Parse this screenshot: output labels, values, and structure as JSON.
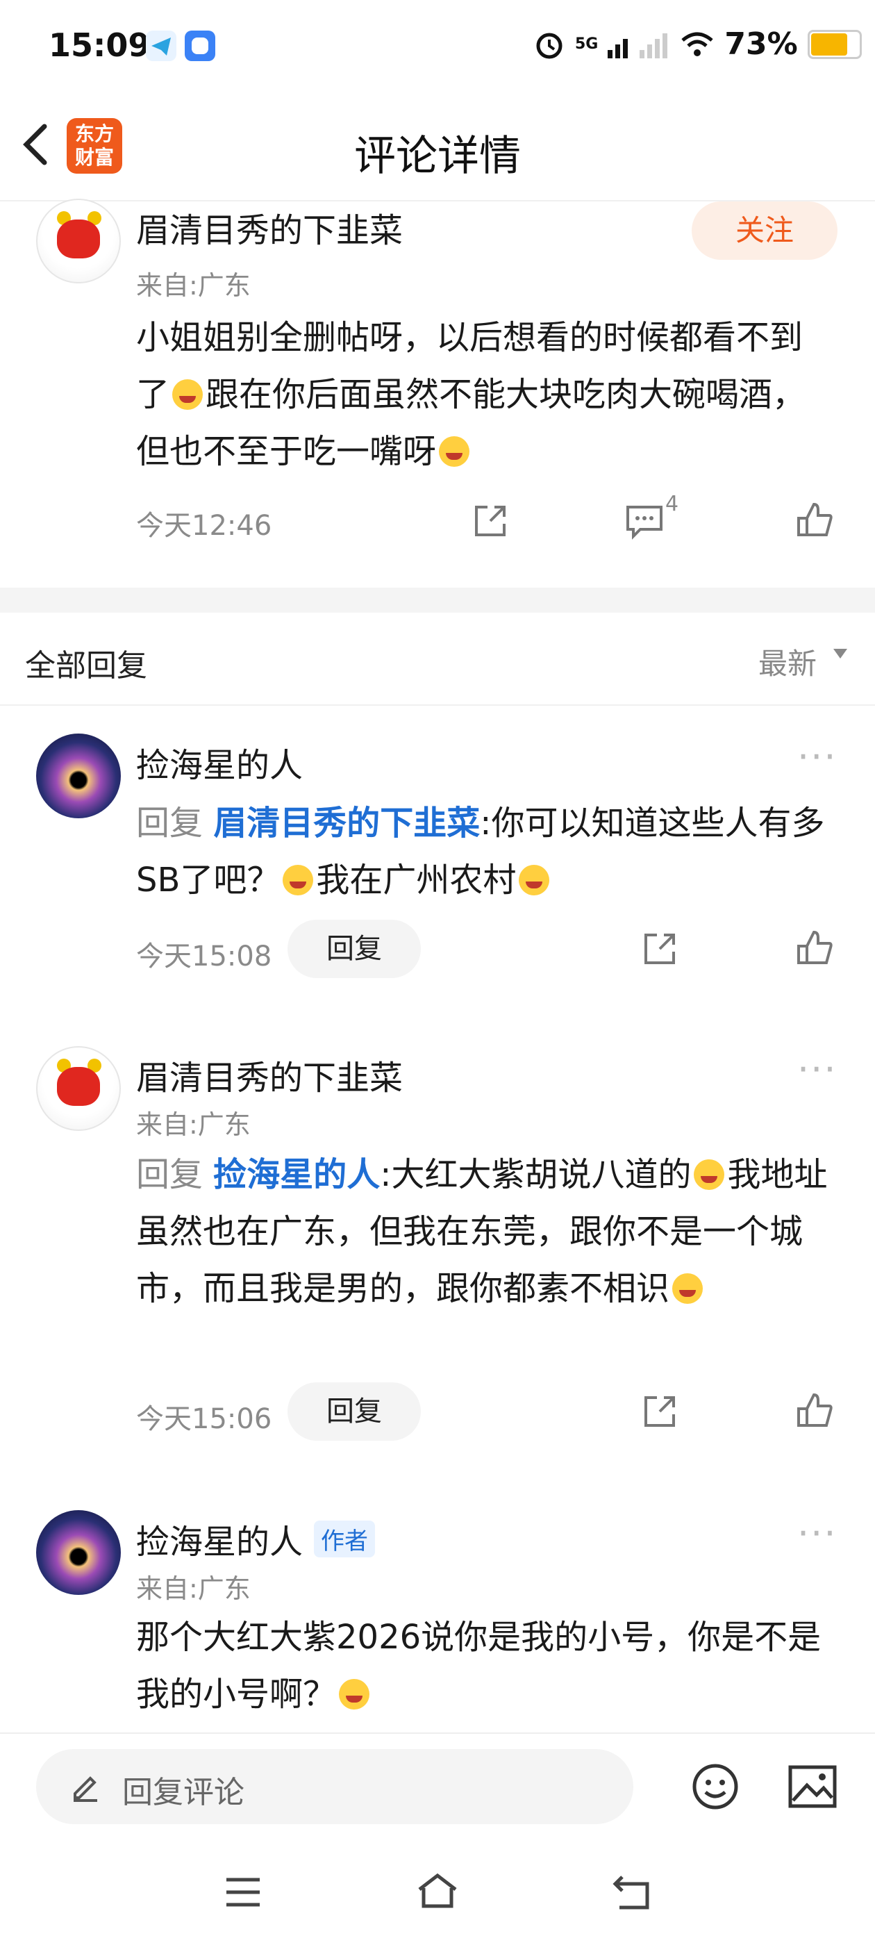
{
  "status_bar": {
    "time": "15:09",
    "network": "5G",
    "battery": "73%",
    "battery_level": 0.73
  },
  "header": {
    "logo_text": "东方财富",
    "title": "评论详情"
  },
  "main_comment": {
    "username": "眉清目秀的下韭菜",
    "location": "来自:广东",
    "follow_label": "关注",
    "text_part1": "小姐姐别全删帖呀，以后想看的时候都看不到了",
    "text_part2": "跟在你后面虽然不能大块吃肉大碗喝酒，但也不至于吃一嘴呀",
    "time": "今天12:46",
    "comment_count": "4"
  },
  "replies_header": {
    "title": "全部回复",
    "sort": "最新"
  },
  "replies": [
    {
      "username": "捡海星的人",
      "reply_prefix": "回复",
      "mention": "眉清目秀的下韭菜",
      "text": ":你可以知道这些人有多SB了吧？",
      "text_after_emoji": "我在广州农村",
      "time": "今天15:08",
      "reply_label": "回复"
    },
    {
      "username": "眉清目秀的下韭菜",
      "location": "来自:广东",
      "reply_prefix": "回复",
      "mention": "捡海星的人",
      "text": ":大红大紫胡说八道的",
      "text_after_emoji": "我地址虽然也在广东，但我在东莞，跟你不是一个城市，而且我是男的，跟你都素不相识",
      "time": "今天15:06",
      "reply_label": "回复"
    },
    {
      "username": "捡海星的人",
      "badge": "作者",
      "location": "来自:广东",
      "text": "那个大红大紫2026说你是我的小号，你是不是我的小号啊？"
    }
  ],
  "bottom": {
    "reply_placeholder": "回复评论"
  }
}
